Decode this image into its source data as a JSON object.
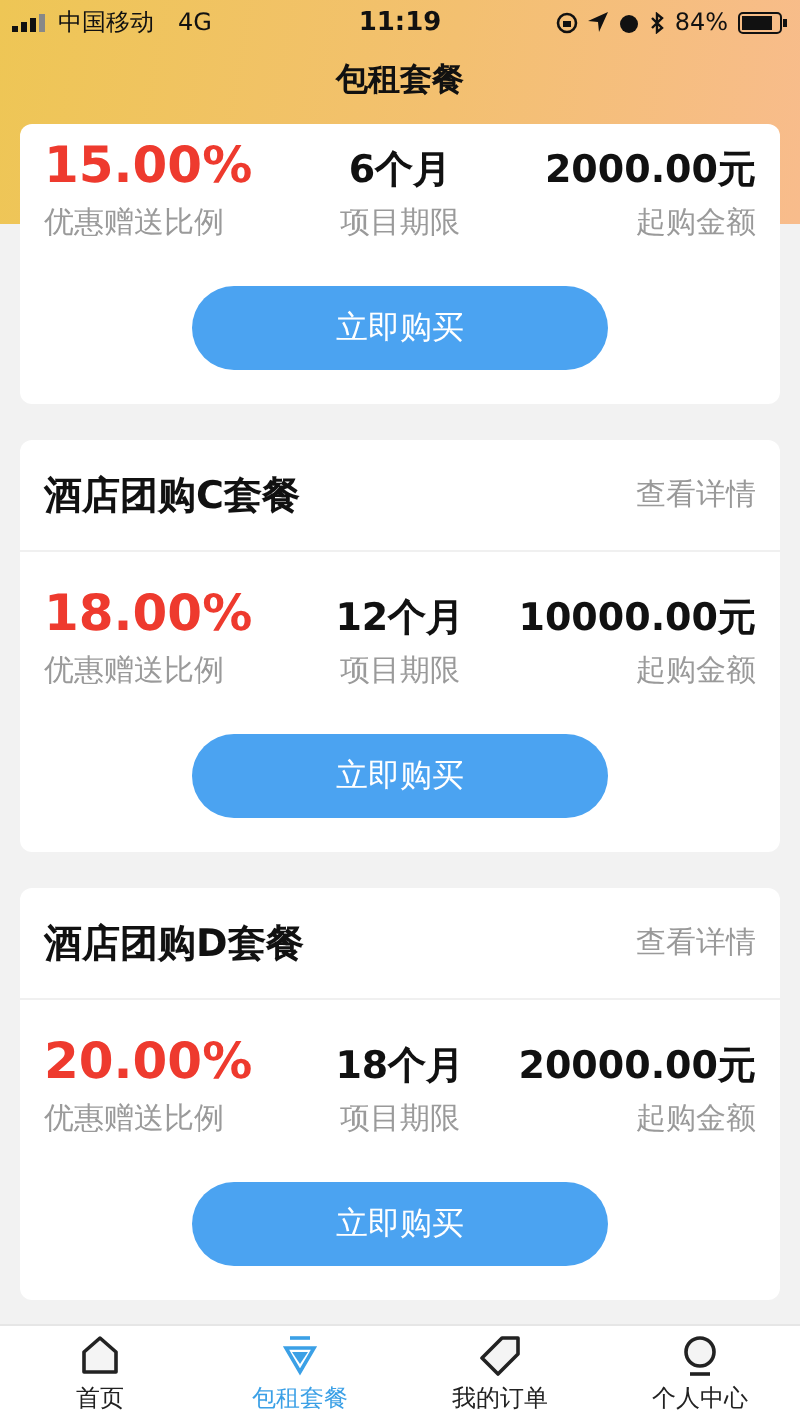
{
  "status_bar": {
    "carrier": "中国移动",
    "network": "4G",
    "time": "11:19",
    "battery": "84%"
  },
  "title": "包租套餐",
  "packages": [
    {
      "rate": "15.00%",
      "rate_label": "优惠赠送比例",
      "term": "6个月",
      "term_label": "项目期限",
      "amount": "2000.00元",
      "amount_label": "起购金额",
      "button": "立即购买"
    },
    {
      "name": "酒店团购C套餐",
      "details": "查看详情",
      "rate": "18.00%",
      "rate_label": "优惠赠送比例",
      "term": "12个月",
      "term_label": "项目期限",
      "amount": "10000.00元",
      "amount_label": "起购金额",
      "button": "立即购买"
    },
    {
      "name": "酒店团购D套餐",
      "details": "查看详情",
      "rate": "20.00%",
      "rate_label": "优惠赠送比例",
      "term": "18个月",
      "term_label": "项目期限",
      "amount": "20000.00元",
      "amount_label": "起购金额",
      "button": "立即购买"
    }
  ],
  "tabs": [
    {
      "label": "首页",
      "selected": false
    },
    {
      "label": "包租套餐",
      "selected": true
    },
    {
      "label": "我的订单",
      "selected": false
    },
    {
      "label": "个人中心",
      "selected": false
    }
  ]
}
